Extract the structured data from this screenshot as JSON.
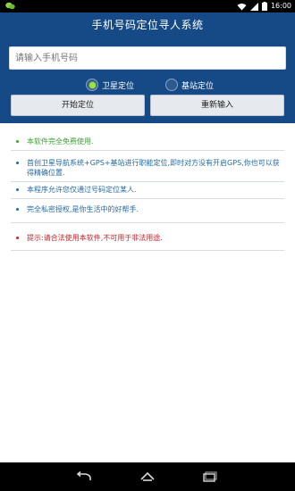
{
  "status_bar": {
    "time": "16:00",
    "icons": [
      "wechat-icon",
      "wifi-icon",
      "signal-icon",
      "battery-icon"
    ]
  },
  "app": {
    "title": "手机号码定位寻人系统"
  },
  "search": {
    "placeholder": "请输入手机号码",
    "value": ""
  },
  "modes": [
    {
      "label": "卫星定位",
      "checked": true
    },
    {
      "label": "基站定位",
      "checked": false
    }
  ],
  "buttons": {
    "start": "开始定位",
    "reset": "重新输入"
  },
  "notes": [
    {
      "text": "本软件完全免费使用.",
      "color": "#3aa12f"
    },
    {
      "text": "首创卫星导航系统+GPS+基站进行职能定位,即时对方没有开启GPS,你也可以获得精确位置.",
      "color": "#246aa3"
    },
    {
      "text": "本程序允许您仅通过号码定位某人.",
      "color": "#246aa3"
    },
    {
      "text": "完全私密授权,是你生活中的好帮手.",
      "color": "#246aa3"
    },
    {
      "text": "提示:请合法使用本软件,不可用于非法用途.",
      "color": "#c0262d"
    }
  ],
  "colors": {
    "header_bg": "#154a86",
    "status_bg": "#000000",
    "nav_bg": "#000000"
  },
  "nav": {
    "icons": [
      "back-icon",
      "home-icon",
      "recent-apps-icon"
    ]
  }
}
